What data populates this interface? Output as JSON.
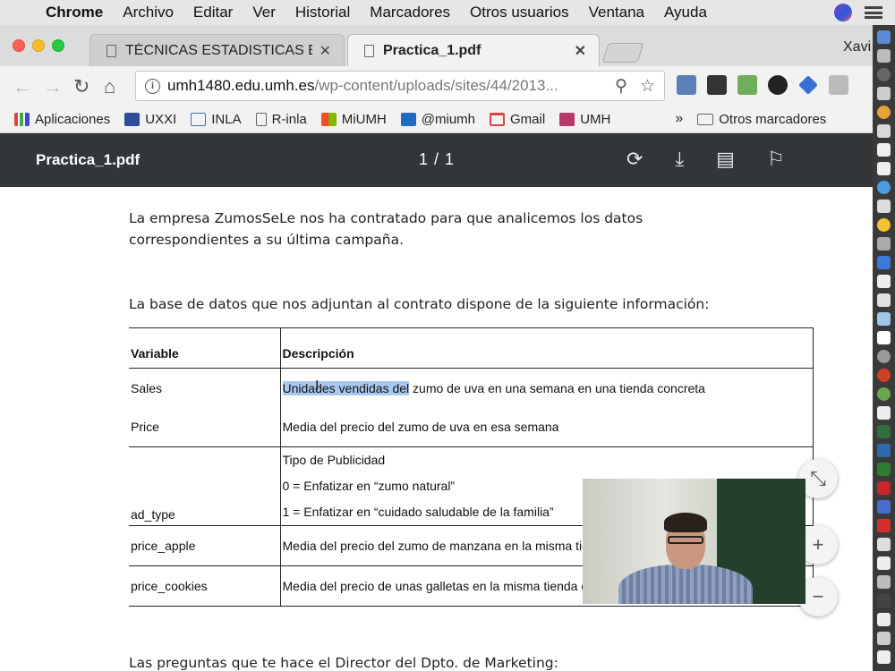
{
  "menubar": {
    "items": [
      "Chrome",
      "Archivo",
      "Editar",
      "Ver",
      "Historial",
      "Marcadores",
      "Otros usuarios",
      "Ventana",
      "Ayuda"
    ]
  },
  "tabs": {
    "inactive_title": "TÉCNICAS ESTADISTICAS EN A",
    "active_title": "Practica_1.pdf",
    "close": "✕",
    "user": "Xavi"
  },
  "omnibox": {
    "host": "umh1480.edu.umh.es",
    "path": "/wp-content/uploads/sites/44/2013..."
  },
  "bookmarks": {
    "items": [
      "Aplicaciones",
      "UXXI",
      "INLA",
      "R-inla",
      "MiUMH",
      "@miumh",
      "Gmail",
      "UMH"
    ],
    "more": "»",
    "other": "Otros marcadores"
  },
  "pdf_viewer": {
    "title": "Practica_1.pdf",
    "page_indicator": "1 / 1"
  },
  "document": {
    "intro": "La empresa ZumosSeLe nos ha contratado para que analicemos los datos correspondientes a su última campaña.",
    "db_intro": "La base de datos que nos adjuntan al contrato dispone de la siguiente información:",
    "table": {
      "header_variable": "Variable",
      "header_desc": "Descripción",
      "sales_var": "Sales",
      "sales_desc_highlight": "Unidades vendidas del",
      "sales_desc_rest": " zumo de uva en una semana en una tienda concreta",
      "price_var": "Price",
      "price_desc": "Media del precio del zumo de uva en esa semana",
      "ad_var": "ad_type",
      "ad_desc_1": "Tipo de Publicidad",
      "ad_desc_2": "0 = Enfatizar en “zumo natural”",
      "ad_desc_3": "1 = Enfatizar en “cuidado saludable de la familia”",
      "apple_var": "price_apple",
      "apple_desc": "Media del precio del zumo de manzana en la misma tienda en la misma semana",
      "cookies_var": "price_cookies",
      "cookies_desc": "Media del precio de  unas galletas en la misma tienda en la misma semana"
    },
    "questions_intro": "Las preguntas que te hace el Director del Dpto. de Marketing:"
  }
}
